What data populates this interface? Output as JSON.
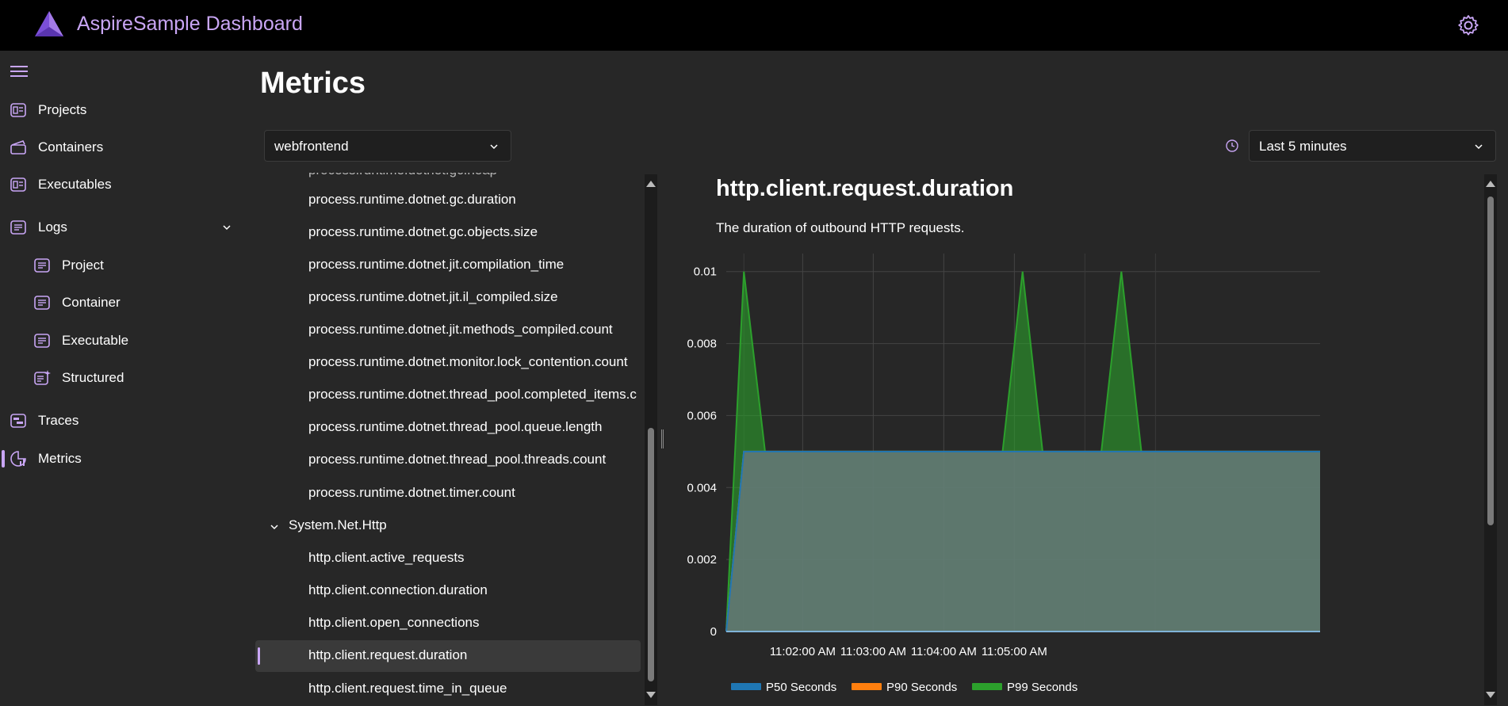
{
  "header": {
    "app_title": "AspireSample Dashboard",
    "logo_icon": "aspire-logo-icon",
    "settings_icon": "gear-icon"
  },
  "sidebar": {
    "items": [
      {
        "label": "Projects",
        "icon": "projects-icon"
      },
      {
        "label": "Containers",
        "icon": "containers-icon"
      },
      {
        "label": "Executables",
        "icon": "executables-icon"
      },
      {
        "label": "Logs",
        "icon": "logs-icon",
        "expanded": true
      },
      {
        "label": "Project",
        "icon": "log-icon"
      },
      {
        "label": "Container",
        "icon": "log-icon"
      },
      {
        "label": "Executable",
        "icon": "log-icon"
      },
      {
        "label": "Structured",
        "icon": "structured-log-icon"
      },
      {
        "label": "Traces",
        "icon": "traces-icon"
      },
      {
        "label": "Metrics",
        "icon": "metrics-icon",
        "active": true
      }
    ]
  },
  "main": {
    "title": "Metrics",
    "resource_select": {
      "value": "webfrontend"
    },
    "time_select": {
      "value": "Last 5 minutes"
    }
  },
  "tree": {
    "items": [
      "process.runtime.dotnet.gc.duration",
      "process.runtime.dotnet.gc.objects.size",
      "process.runtime.dotnet.jit.compilation_time",
      "process.runtime.dotnet.jit.il_compiled.size",
      "process.runtime.dotnet.jit.methods_compiled.count",
      "process.runtime.dotnet.monitor.lock_contention.count",
      "process.runtime.dotnet.thread_pool.completed_items.c",
      "process.runtime.dotnet.thread_pool.queue.length",
      "process.runtime.dotnet.thread_pool.threads.count",
      "process.runtime.dotnet.timer.count"
    ],
    "group": "System.Net.Http",
    "group_items": [
      "http.client.active_requests",
      "http.client.connection.duration",
      "http.client.open_connections",
      "http.client.request.duration",
      "http.client.request.time_in_queue"
    ],
    "selected": "http.client.request.duration"
  },
  "metric": {
    "title": "http.client.request.duration",
    "description": "The duration of outbound HTTP requests."
  },
  "colors": {
    "accent": "#c9a6f5",
    "p50": "#1f77b4",
    "p90": "#ff7f0e",
    "p99": "#2ca02c"
  },
  "chart_data": {
    "type": "area",
    "x_ticks": [
      "11:02:00 AM",
      "11:03:00 AM",
      "11:04:00 AM",
      "11:05:00 AM"
    ],
    "y_ticks": [
      "0",
      "0.002",
      "0.004",
      "0.006",
      "0.008",
      "0.01"
    ],
    "ylim": [
      0,
      0.0105
    ],
    "xlim_seconds": [
      -65,
      440
    ],
    "series": [
      {
        "name": "P50 Seconds",
        "color": "#1f77b4",
        "x_seconds": [
          -65,
          -50,
          440
        ],
        "values": [
          0,
          0.005,
          0.005
        ]
      },
      {
        "name": "P90 Seconds",
        "color": "#ff7f0e",
        "x_seconds": [
          -65,
          -50,
          440
        ],
        "values": [
          0,
          0.005,
          0.005
        ]
      },
      {
        "name": "P99 Seconds",
        "color": "#2ca02c",
        "x_seconds": [
          -65,
          -50,
          -32,
          170,
          187,
          204,
          254,
          271,
          288,
          440
        ],
        "values": [
          0,
          0.01,
          0.005,
          0.005,
          0.01,
          0.005,
          0.005,
          0.01,
          0.005,
          0.005
        ]
      }
    ],
    "legend": [
      "P50 Seconds",
      "P90 Seconds",
      "P99 Seconds"
    ],
    "grid": true
  }
}
